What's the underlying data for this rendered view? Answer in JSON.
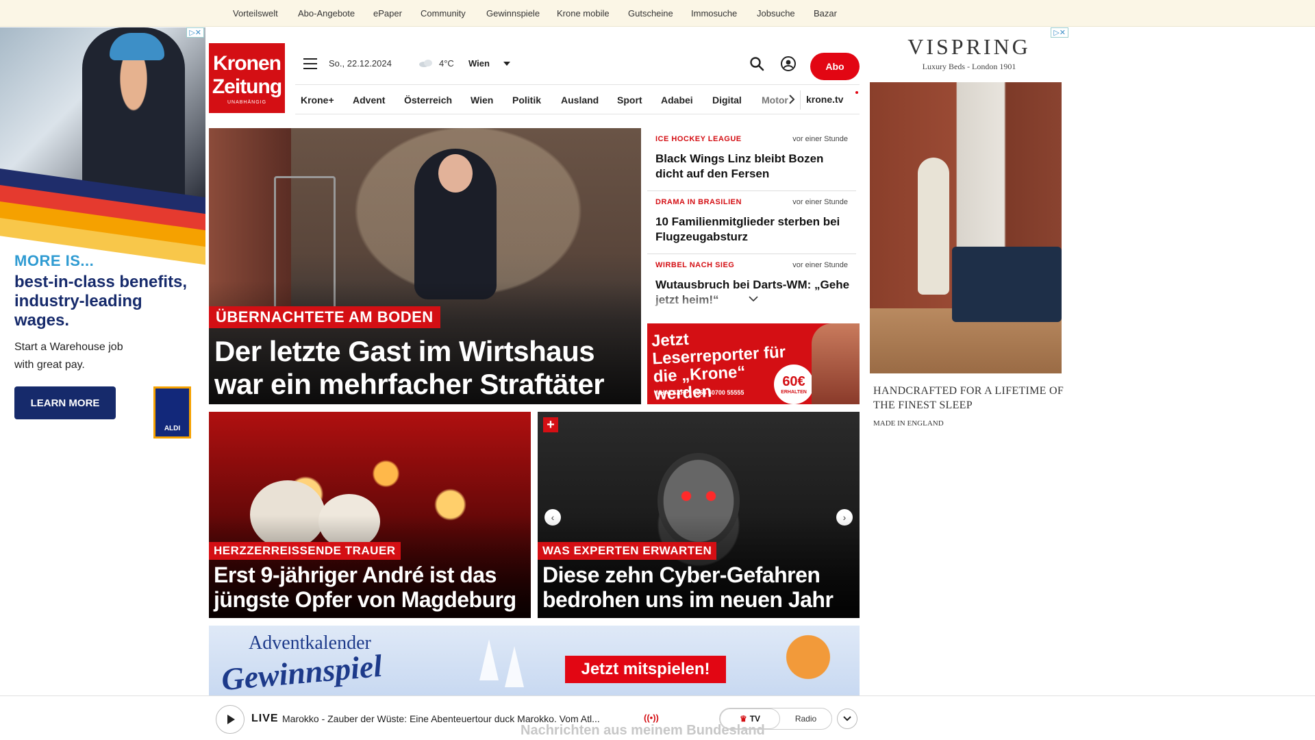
{
  "topbar": {
    "links": [
      "Vorteilswelt",
      "Abo-Angebote",
      "ePaper",
      "Community",
      "Gewinnspiele",
      "Krone mobile",
      "Gutscheine",
      "Immosuche",
      "Jobsuche",
      "Bazar"
    ]
  },
  "left_ad": {
    "more": "MORE IS...",
    "headline": "best-in-class benefits, industry-leading wages.",
    "sub": "Start a Warehouse job with great pay.",
    "cta": "LEARN MORE",
    "logo": "ALDI"
  },
  "right_ad": {
    "brand": "VISPRING",
    "tagline": "Luxury Beds - London 1901",
    "line1": "HANDCRAFTED FOR A LIFETIME OF THE FINEST SLEEP",
    "line2": "MADE IN ENGLAND"
  },
  "logo": {
    "line1": "Kronen",
    "line2": "Zeitung",
    "line3": "UNABHÄNGIG"
  },
  "header": {
    "date": "So., 22.12.2024",
    "weather_icon": "cloud-icon",
    "temperature": "4°C",
    "city": "Wien",
    "abo_label": "Abo"
  },
  "nav": {
    "items": [
      "Krone+",
      "Advent",
      "Österreich",
      "Wien",
      "Politik",
      "Ausland",
      "Sport",
      "Adabei",
      "Digital",
      "Motor"
    ],
    "tv": "krone.tv"
  },
  "hero": {
    "kicker": "ÜBERNACHTETE AM BODEN",
    "title": "Der letzte Gast im Wirtshaus war ein mehrfacher Straftäter"
  },
  "ticker": [
    {
      "category": "ICE HOCKEY LEAGUE",
      "time": "vor einer Stunde",
      "title": "Black Wings Linz bleibt Bozen dicht auf den Fersen"
    },
    {
      "category": "DRAMA IN BRASILIEN",
      "time": "vor einer Stunde",
      "title": "10 Familienmitglieder sterben bei Flugzeugabsturz"
    },
    {
      "category": "WIRBEL NACH SIEG",
      "time": "vor einer Stunde",
      "title": "Wutausbruch bei Darts-WM: „Gehe jetzt heim!“"
    }
  ],
  "reporter": {
    "text": "Jetzt Leserreporter für die „Krone“ werden",
    "whatsapp": "WHATSAPP: 0664 60700 55555",
    "badge_amount": "60€",
    "badge_label": "ERHALTEN"
  },
  "cards": [
    {
      "kicker": "HERZZERREISSENDE TRAUER",
      "title": "Erst 9-jähriger André ist das jüngste Opfer von Magdeburg"
    },
    {
      "kicker": "WAS EXPERTEN ERWARTEN",
      "title": "Diese zehn Cyber-Gefahren bedrohen uns im neuen Jahr"
    }
  ],
  "advent": {
    "line1": "Adventkalender",
    "line2": "Gewinnspiel",
    "button": "Jetzt mitspielen!"
  },
  "player": {
    "live": "LIVE",
    "show": "Marokko - Zauber der Wüste: Eine Abenteuertour duck Marokko. Vom Atl...",
    "tab_tv": "TV",
    "tab_radio": "Radio",
    "under_text": "Nachrichten aus meinem Bundesland"
  },
  "colors": {
    "brand_red": "#d40f14",
    "abo_red": "#e20613",
    "topbar_bg": "#fbf6e6"
  }
}
